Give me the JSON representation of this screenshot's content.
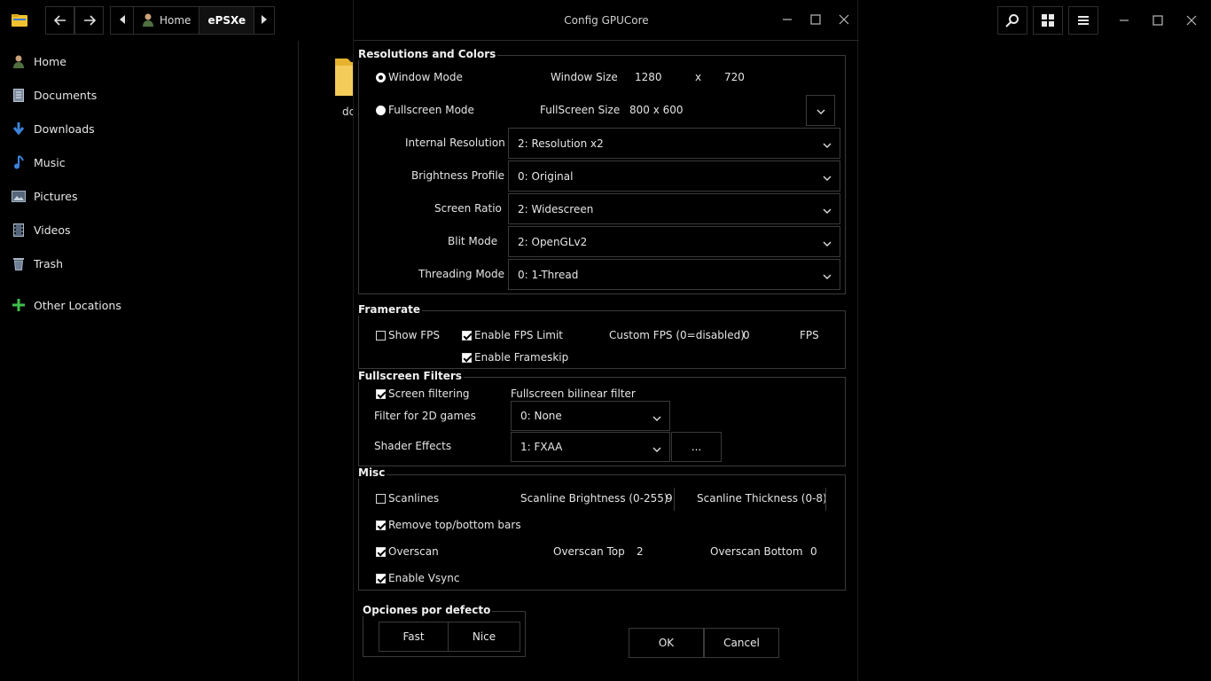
{
  "header": {
    "breadcrumbs": [
      "Home",
      "ePSXe"
    ]
  },
  "sidebar": {
    "items": [
      {
        "label": "Home",
        "icon": "home-icon"
      },
      {
        "label": "Documents",
        "icon": "documents-icon"
      },
      {
        "label": "Downloads",
        "icon": "downloads-icon"
      },
      {
        "label": "Music",
        "icon": "music-icon"
      },
      {
        "label": "Pictures",
        "icon": "pictures-icon"
      },
      {
        "label": "Videos",
        "icon": "videos-icon"
      },
      {
        "label": "Trash",
        "icon": "trash-icon"
      },
      {
        "label": "Other Locations",
        "icon": "plus-icon"
      }
    ]
  },
  "content": {
    "folder_label": "dc"
  },
  "dialog": {
    "title": "Config GPUCore",
    "resolutions": {
      "title": "Resolutions and Colors",
      "window_mode_label": "Window Mode",
      "window_size_label": "Window Size",
      "window_width": "1280",
      "x_label": "x",
      "window_height": "720",
      "fullscreen_mode_label": "Fullscreen Mode",
      "fullscreen_size_label": "FullScreen Size",
      "fullscreen_size_value": "800 x 600",
      "internal_resolution_label": "Internal Resolution",
      "internal_resolution_value": "2: Resolution x2",
      "brightness_profile_label": "Brightness Profile",
      "brightness_profile_value": "0: Original",
      "screen_ratio_label": "Screen Ratio",
      "screen_ratio_value": "2: Widescreen",
      "blit_mode_label": "Blit Mode",
      "blit_mode_value": "2: OpenGLv2",
      "threading_mode_label": "Threading Mode",
      "threading_mode_value": "0: 1-Thread"
    },
    "framerate": {
      "title": "Framerate",
      "show_fps_label": "Show FPS",
      "show_fps_checked": false,
      "enable_fps_limit_label": "Enable FPS Limit",
      "enable_fps_limit_checked": true,
      "custom_fps_label": "Custom FPS (0=disabled)",
      "custom_fps_value": "0",
      "fps_unit": "FPS",
      "enable_frameskip_label": "Enable Frameskip",
      "enable_frameskip_checked": true
    },
    "filters": {
      "title": "Fullscreen Filters",
      "screen_filtering_label": "Screen filtering",
      "screen_filtering_checked": true,
      "bilinear_label": "Fullscreen bilinear filter",
      "filter_2d_label": "Filter for 2D games",
      "filter_2d_value": "0: None",
      "shader_effects_label": "Shader Effects",
      "shader_effects_value": "1: FXAA",
      "shader_more_label": "..."
    },
    "misc": {
      "title": "Misc",
      "scanlines_label": "Scanlines",
      "scanlines_checked": false,
      "scanline_brightness_label": "Scanline Brightness (0-255)",
      "scanline_brightness_value": "9(",
      "scanline_thickness_label": "Scanline Thickness (0-8)",
      "remove_bars_label": "Remove top/bottom bars",
      "remove_bars_checked": true,
      "overscan_label": "Overscan",
      "overscan_checked": true,
      "overscan_top_label": "Overscan Top",
      "overscan_top_value": "2",
      "overscan_bottom_label": "Overscan Bottom",
      "overscan_bottom_value": "0",
      "vsync_label": "Enable Vsync",
      "vsync_checked": true
    },
    "defaults": {
      "title": "Opciones por defecto",
      "fast_label": "Fast",
      "nice_label": "Nice"
    },
    "ok_label": "OK",
    "cancel_label": "Cancel"
  }
}
